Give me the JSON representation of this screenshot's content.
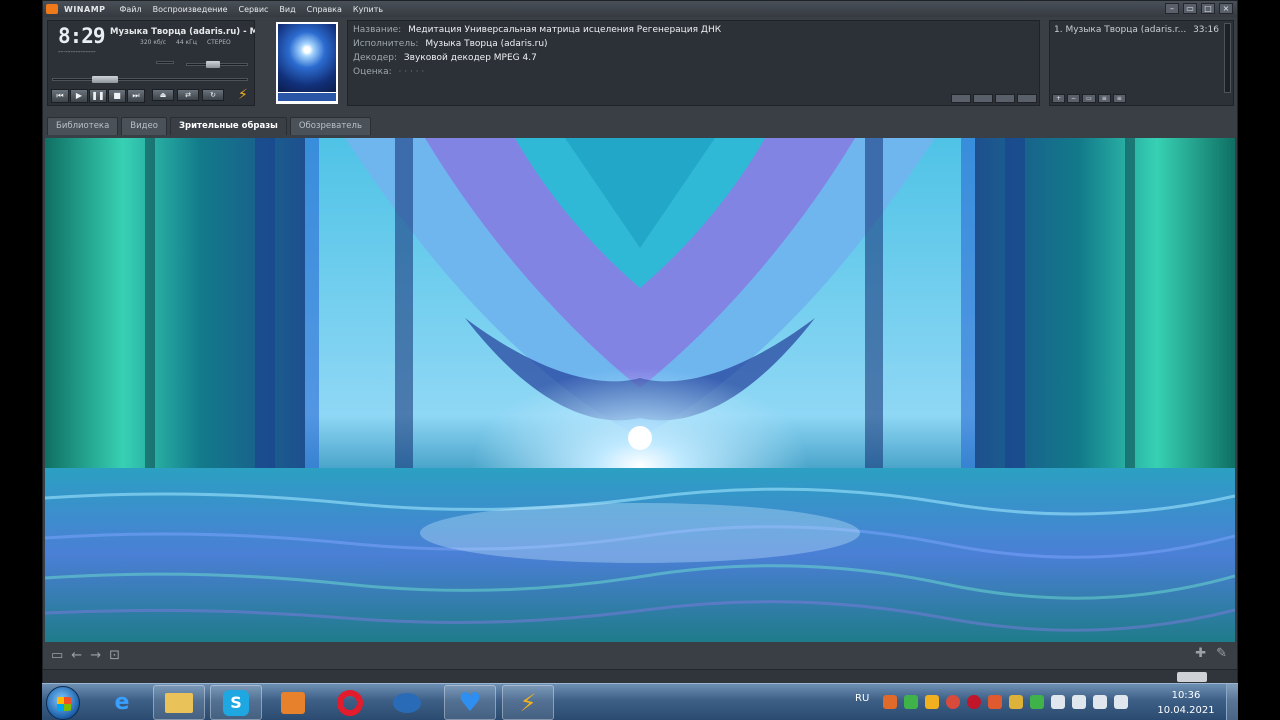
{
  "menubar": {
    "app_name": "WINAMP",
    "items": [
      "Файл",
      "Воспроизведение",
      "Сервис",
      "Вид",
      "Справка",
      "Купить"
    ]
  },
  "player": {
    "time": "8:29",
    "ticker": "Музыка Творца (adaris.ru) - Ме",
    "bitrate": "320 кб/с",
    "samplerate": "44 кГц",
    "channels": "СТЕРЕО",
    "mini_vis": "--·------------",
    "seek_progress": 0.23,
    "volume_level": 0.4,
    "icons": [
      "prev-icon",
      "play-icon",
      "pause-icon",
      "stop-icon",
      "next-icon",
      "eject-icon",
      "lightning-icon"
    ]
  },
  "info": {
    "title_label": "Название:",
    "title_value": "Медитация Универсальная матрица исцеления Регенерация ДНК",
    "artist_label": "Исполнитель:",
    "artist_value": "Музыка Творца (adaris.ru)",
    "decoder_label": "Декодер:",
    "decoder_value": "Звуковой декодер MPEG 4.7",
    "rating_label": "Оценка:",
    "rating_value": "· · · · ·"
  },
  "playlist": {
    "item": "1. Музыка Творца (adaris.r...",
    "duration": "33:16"
  },
  "tabs": [
    {
      "label": "Библиотека",
      "active": false
    },
    {
      "label": "Видео",
      "active": false
    },
    {
      "label": "Зрительные образы",
      "active": true
    },
    {
      "label": "Обозреватель",
      "active": false
    }
  ],
  "vis_toolbar": {
    "icons": [
      "fullscreen-icon",
      "back-icon",
      "forward-icon",
      "vis-menu-icon",
      "plugin-icon",
      "settings-icon"
    ]
  },
  "taskbar": {
    "apps": [
      "internet-explorer-icon",
      "explorer-icon",
      "skype-icon",
      "media-player-icon",
      "opera-icon",
      "vpn-icon",
      "heart-app-icon",
      "winamp-icon"
    ],
    "language": "RU",
    "time": "10:36",
    "date": "10.04.2021"
  },
  "colors": {
    "accent_orange": "#f07a1a",
    "vis_teal": "#1fb7a8",
    "vis_blue": "#5a9cf2",
    "vis_purple": "#8a5ad6"
  }
}
